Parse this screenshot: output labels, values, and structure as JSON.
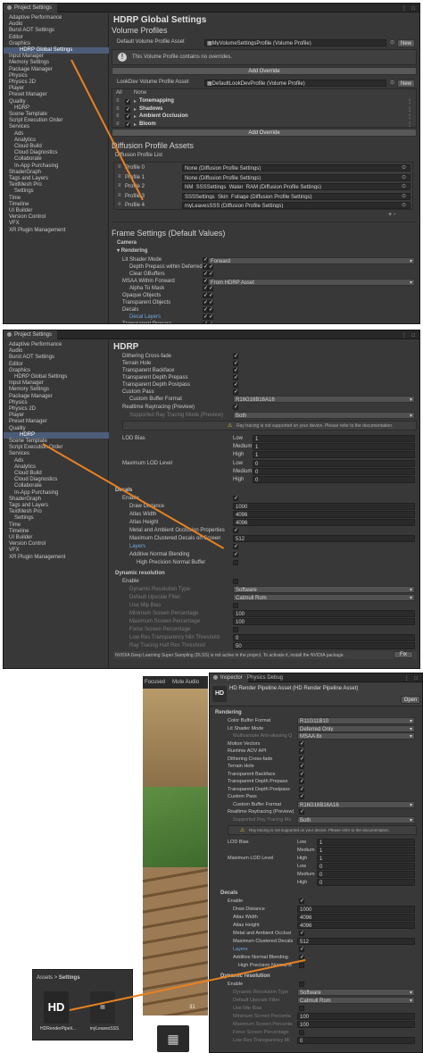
{
  "colors": {
    "accent_line": "#e8811f",
    "selection": "#4d5d78",
    "panel": "#383838",
    "field": "#2a2a2a"
  },
  "win1": {
    "tab": "Project Settings",
    "sidebar": [
      "Adaptive Performance",
      "Audio",
      "Burst AOT Settings",
      "Editor",
      "Graphics",
      "HDRP Global Settings",
      "Input Manager",
      "Memory Settings",
      "Package Manager",
      "Physics",
      "Physics 2D",
      "Player",
      "Preset Manager",
      "Quality",
      "HDRP",
      "Scene Template",
      "Script Execution Order",
      "Services",
      "Ads",
      "Analytics",
      "Cloud Build",
      "Cloud Diagnostics",
      "Collaborate",
      "In-App Purchasing",
      "ShaderGraph",
      "Tags and Layers",
      "TextMesh Pro",
      "Settings",
      "Time",
      "Timeline",
      "UI Builder",
      "Version Control",
      "VFX",
      "XR Plugin Management"
    ],
    "title": "HDRP Global Settings",
    "volume_profiles": "Volume Profiles",
    "default_volume_label": "Default Volume Profile Asset",
    "default_volume_value": "MyVolumeSettingsProfile (Volume Profile)",
    "new_label": "New",
    "info_text": "This Volume Profile contains no overrides.",
    "add_override": "Add Override",
    "lookdev_label": "LookDev Volume Profile Asset",
    "lookdev_value": "DefaultLookDevProfile (Volume Profile)",
    "all": "All",
    "none": "None",
    "overrides": [
      "Tonemapping",
      "Shadows",
      "Ambient Occlusion",
      "Bloom"
    ],
    "diffusion_title": "Diffusion Profile Assets",
    "diffusion_list": "Diffusion Profile List",
    "profiles": [
      {
        "name": "Profile 0",
        "value": "None (Diffusion Profile Settings)"
      },
      {
        "name": "Profile 1",
        "value": "None (Diffusion Profile Settings)"
      },
      {
        "name": "Profile 2",
        "value": "NM_SSSSettings_Water_RAM (Diffusion Profile Settings)"
      },
      {
        "name": "Profile 3",
        "value": "SSSSettings_Skin_Foliage (Diffusion Profile Settings)"
      },
      {
        "name": "Profile 4",
        "value": "myLeavesSSS (Diffusion Profile Settings)"
      }
    ],
    "plus_minus": "+ -",
    "frame_title": "Frame Settings (Default Values)",
    "camera": "Camera",
    "rendering": "Rendering",
    "lit_shader": "Lit Shader Mode",
    "lit_shader_value": "Forward",
    "depth_prepass": "Depth Prepass within Deferred",
    "clear_gbuffers": "Clear GBuffers",
    "msaa": "MSAA Within Forward",
    "msaa_value": "From HDRP Asset",
    "alpha_mask": "Alpha To Mask",
    "opaque": "Opaque Objects",
    "transparent": "Transparent Objects",
    "decals": "Decals",
    "decal_layers": "Decal Layers",
    "transparent_prepass": "Transparent Prepass"
  },
  "win2": {
    "tab": "Project Settings",
    "sidebar": [
      "Adaptive Performance",
      "Audio",
      "Burst AOT Settings",
      "Editor",
      "Graphics",
      "HDRP Global Settings",
      "Input Manager",
      "Memory Settings",
      "Package Manager",
      "Physics",
      "Physics 2D",
      "Player",
      "Preset Manager",
      "Quality",
      "HDRP",
      "Scene Template",
      "Script Execution Order",
      "Services",
      "Ads",
      "Analytics",
      "Cloud Build",
      "Cloud Diagnostics",
      "Collaborate",
      "In-App Purchasing",
      "ShaderGraph",
      "Tags and Layers",
      "TextMesh Pro",
      "Settings",
      "Time",
      "Timeline",
      "UI Builder",
      "Version Control",
      "VFX",
      "XR Plugin Management"
    ],
    "title": "HDRP",
    "rows": [
      "Dithering Cross-fade",
      "Terrain Hole",
      "Transparent Backface",
      "Transparent Depth Prepass",
      "Transparent Depth Postpass",
      "Custom Pass"
    ],
    "custom_buffer": "Custom Buffer Format",
    "custom_buffer_value": "R16G16B16A16",
    "raytracing": "Realtime Raytracing (Preview)",
    "supported_rt": "Supported Ray Tracing Mode (Preview)",
    "supported_rt_value": "Both",
    "rt_warning": "Ray tracing is not supported on your device. Please refer to the documentation.",
    "lod_bias": "LOD Bias",
    "max_lod": "Maximum LOD Level",
    "low": "Low",
    "medium": "Medium",
    "high": "High",
    "lod_bias_values": [
      "1",
      "1",
      "1"
    ],
    "max_lod_values": [
      "0",
      "0",
      "0"
    ],
    "decals": "Decals",
    "enable": "Enable",
    "draw_distance": "Draw Distance",
    "draw_distance_value": "1000",
    "atlas_width": "Atlas Width",
    "atlas_width_value": "4096",
    "atlas_height": "Atlas Height",
    "atlas_height_value": "4096",
    "metal_ao": "Metal and Ambient Occlusion Properties",
    "max_clustered": "Maximum Clustered Decals on Screen",
    "max_clustered_value": "512",
    "layers": "Layers",
    "additive_normal": "Additive Normal Blending",
    "hp_normal": "High Precision Normal Buffer",
    "dyn_res": "Dynamic resolution",
    "dyn_res_type": "Dynamic Resolution Type",
    "dyn_res_type_value": "Software",
    "upscale": "Default Upscale Filter",
    "upscale_value": "Catmull Rom",
    "use_mip": "Use Mip Bias",
    "min_screen": "Minimum Screen Percentage",
    "min_screen_value": "100",
    "max_screen": "Maximum Screen Percentage",
    "max_screen_value": "100",
    "force_screen": "Force Screen Percentage",
    "low_res_min": "Low Res Transparency Min Threshold",
    "low_res_min_value": "0",
    "ray_half": "Ray Tracing Half Res Threshold",
    "ray_half_value": "50",
    "dlss_note": "NVIDIA Deep Learning Super Sampling (DLSS) is not active in the project. To activate it, install the NVIDIA package.",
    "fix": "Fix"
  },
  "win3": {
    "scene_focused": "Focused",
    "scene_mute": "Mute Audio",
    "tab_inspector": "Inspector",
    "tab_physics": "Physics Debug",
    "asset_title": "HD Render Pipeline Asset (HD Render Pipeline Asset)",
    "hd_icon": "HD",
    "open": "Open",
    "rendering": "Rendering",
    "color_buffer": "Color Buffer Format",
    "color_buffer_value": "R11G11B10",
    "lit_shader": "Lit Shader Mode",
    "lit_shader_value": "Deferred Only",
    "msaa": "Multisample Anti-aliasing Q",
    "msaa_value": "MSAA 8x",
    "checks": [
      "Motion Vectors",
      "Runtime AOV API",
      "Dithering Cross-fade",
      "Terrain Hole",
      "Transparent Backface",
      "Transparent Depth Prepass",
      "Transparent Depth Postpass",
      "Custom Pass"
    ],
    "custom_buffer": "Custom Buffer Format",
    "custom_buffer_value": "R16G16B16A16",
    "raytracing": "Realtime Raytracing (Preview)",
    "supported_rt": "Supported Ray Tracing Mo",
    "supported_rt_value": "Both",
    "rt_warning": "Ray tracing is not supported on your device. Please refer to the documentation.",
    "lod_bias": "LOD Bias",
    "max_lod": "Maximum LOD Level",
    "low": "Low",
    "medium": "Medium",
    "high": "High",
    "lod_bias_values": [
      "1",
      "1",
      "1"
    ],
    "max_lod_values": [
      "0",
      "0",
      "0"
    ],
    "decals": "Decals",
    "enable": "Enable",
    "draw_distance": "Draw Distance",
    "draw_distance_value": "1000",
    "atlas_width": "Atlas Width",
    "atlas_width_value": "4096",
    "atlas_height": "Atlas Height",
    "atlas_height_value": "4096",
    "metal_ao": "Metal and Ambient Occlusi",
    "max_clustered": "Maximum Clustered Decals",
    "max_clustered_value": "512",
    "layers": "Layers",
    "additive_normal": "Additive Normal Blending",
    "hp_normal": "High Precision Normal B",
    "dyn_res": "Dynamic resolution",
    "dyn_res_type": "Dynamic Resolution Type",
    "dyn_res_type_value": "Software",
    "upscale": "Default Upscale Filter",
    "upscale_value": "Catmull Rom",
    "use_mip": "Use Mip Bias",
    "min_screen": "Minimum Screen Percenta",
    "min_screen_value": "100",
    "max_screen": "Maximum Screen Percenta",
    "max_screen_value": "100",
    "force_screen": "Force Screen Percentage",
    "low_res_min": "Low Res Transparency Mi",
    "low_res_min_value": "0"
  },
  "project": {
    "breadcrumb_assets": "Assets",
    "breadcrumb_sep": ">",
    "breadcrumb_settings": "Settings",
    "items": [
      {
        "icon": "HD",
        "label": "HDRenderPipeli..."
      },
      {
        "icon": "SSS",
        "label": "myLeavesSSS"
      }
    ]
  },
  "scene_label": "31"
}
